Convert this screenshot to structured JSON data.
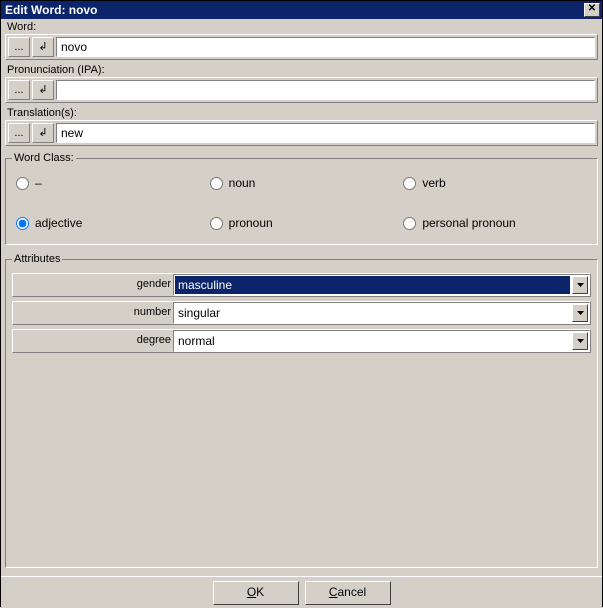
{
  "title": "Edit Word: novo",
  "fields": {
    "word": {
      "label": "Word:",
      "value": "novo"
    },
    "pronunciation": {
      "label": "Pronunciation (IPA):",
      "value": ""
    },
    "translation": {
      "label": "Translation(s):",
      "value": "new"
    }
  },
  "wordclass": {
    "legend": "Word Class:",
    "options": [
      "–",
      "noun",
      "verb",
      "adjective",
      "pronoun",
      "personal pronoun"
    ],
    "selected": "adjective"
  },
  "attributes": {
    "legend": "Attributes",
    "gender": {
      "label": "gender",
      "value": "masculine"
    },
    "number": {
      "label": "number",
      "value": "singular"
    },
    "degree": {
      "label": "degree",
      "value": "normal"
    }
  },
  "buttons": {
    "ok": "OK",
    "cancel": "Cancel"
  },
  "ellipsis": "...",
  "enter_glyph": "↲"
}
